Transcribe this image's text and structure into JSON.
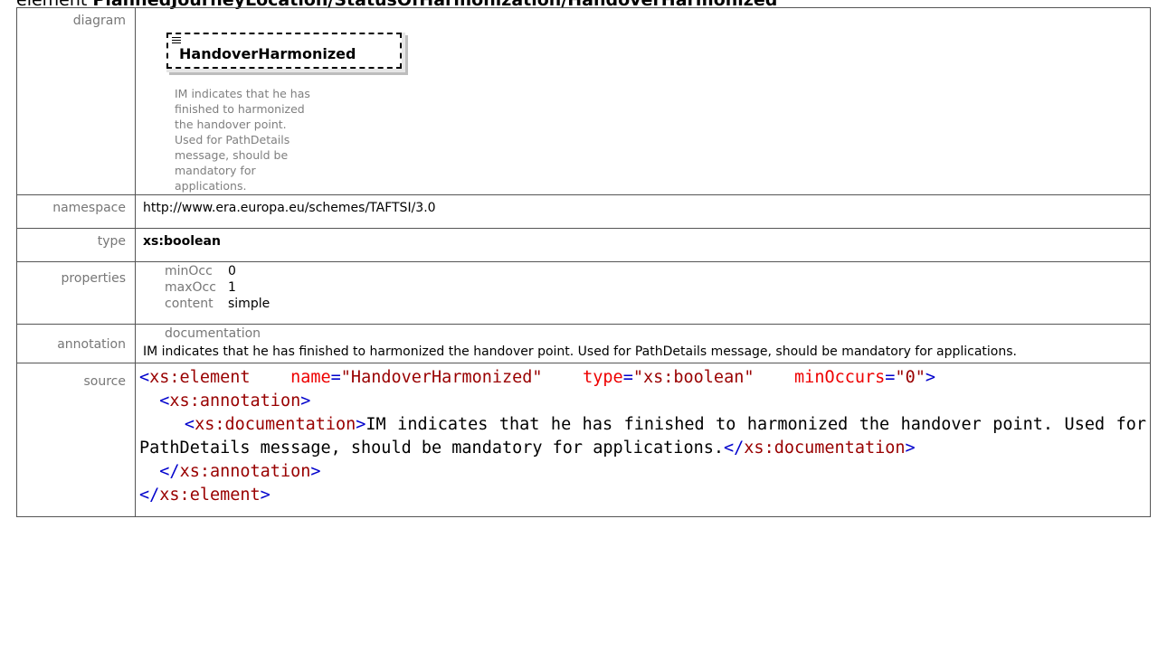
{
  "heading": {
    "prefix": "element ",
    "path": "PlannedJourneyLocation/StatusOfHarmonization/HandoverHarmonized"
  },
  "rows": {
    "diagram_label": "diagram",
    "namespace_label": "namespace",
    "type_label": "type",
    "properties_label": "properties",
    "annotation_label": "annotation",
    "source_label": "source"
  },
  "diagram": {
    "element_name": "HandoverHarmonized",
    "description": "IM indicates that he has finished to harmonized the handover point. Used for PathDetails message, should be mandatory for applications.",
    "icon": "documentation-icon"
  },
  "namespace": "http://www.era.europa.eu/schemes/TAFTSI/3.0",
  "type": "xs:boolean",
  "properties": [
    {
      "key": "minOcc",
      "value": "0"
    },
    {
      "key": "maxOcc",
      "value": "1"
    },
    {
      "key": "content",
      "value": "simple"
    }
  ],
  "annotation": {
    "header": "documentation",
    "text": "IM indicates that he has finished to harmonized the handover point. Used for PathDetails message, should be mandatory for applications."
  },
  "source": {
    "tag_element": "xs:element",
    "attr_name": "name",
    "attr_name_value": "\"HandoverHarmonized\"",
    "attr_type": "type",
    "attr_type_value": "\"xs:boolean\"",
    "attr_min": "minOccurs",
    "attr_min_value": "\"0\"",
    "tag_annotation": "xs:annotation",
    "tag_documentation": "xs:documentation",
    "doc_text": "IM indicates that he has finished to harmonized the handover point. Used for PathDetails message, should be mandatory for applications."
  }
}
